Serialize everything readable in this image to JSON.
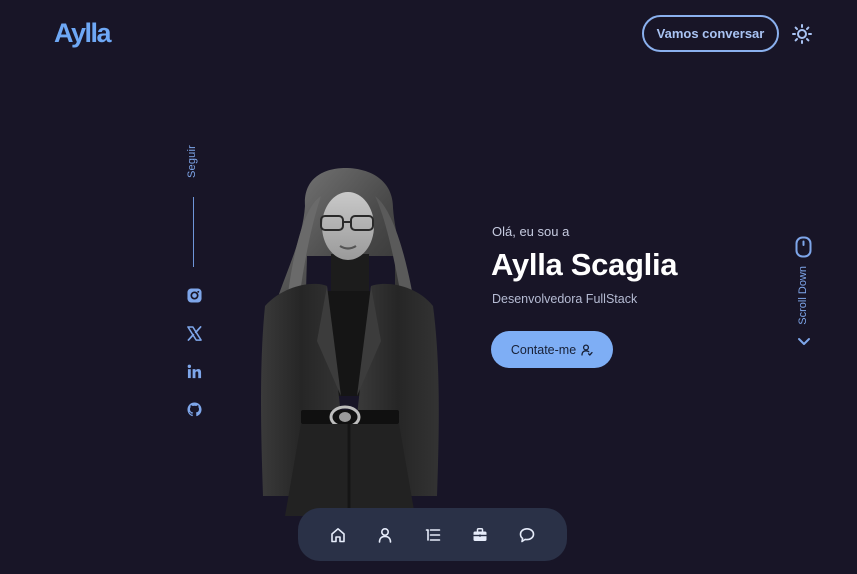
{
  "header": {
    "logo": "Aylla",
    "cta_label": "Vamos conversar",
    "theme_icon": "sun-icon"
  },
  "social": {
    "label": "Seguir",
    "items": [
      {
        "name": "instagram",
        "icon": "instagram-icon"
      },
      {
        "name": "x",
        "icon": "x-icon"
      },
      {
        "name": "linkedin",
        "icon": "linkedin-icon"
      },
      {
        "name": "github",
        "icon": "github-icon"
      }
    ]
  },
  "hero": {
    "greeting": "Olá, eu sou a",
    "name": "Aylla Scaglia",
    "role": "Desenvolvedora FullStack",
    "cta_label": "Contate-me",
    "cta_icon": "user-icon"
  },
  "scroll": {
    "label": "Scroll Down",
    "icon": "mouse-icon"
  },
  "nav": {
    "items": [
      {
        "name": "home",
        "icon": "home-icon"
      },
      {
        "name": "about",
        "icon": "user-icon"
      },
      {
        "name": "skills",
        "icon": "list-icon"
      },
      {
        "name": "portfolio",
        "icon": "briefcase-icon"
      },
      {
        "name": "contact",
        "icon": "message-icon"
      }
    ]
  },
  "colors": {
    "background": "#181527",
    "accent": "#7eaef5",
    "logo": "#6ea8f5",
    "nav_background": "#2a3147"
  }
}
